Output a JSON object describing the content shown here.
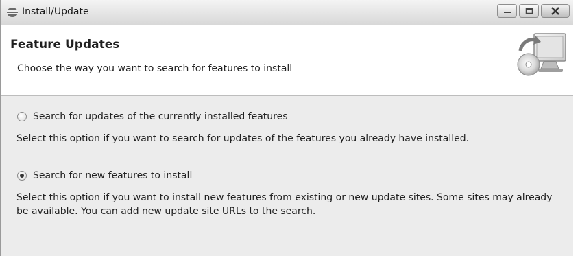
{
  "window": {
    "title": "Install/Update",
    "icon": "install-update-icon",
    "caption_buttons": [
      "minimize-icon",
      "maximize-icon",
      "close-icon"
    ]
  },
  "header": {
    "title": "Feature Updates",
    "description": "Choose the way you want to search for features to install",
    "banner_icon": "update-monitor-cd-icon"
  },
  "options": [
    {
      "label": "Search for updates of the currently installed features",
      "description": "Select this option if you want to search for updates of the features you already have installed.",
      "selected": false
    },
    {
      "label": "Search for new features to install",
      "description": "Select this option if you want to install new features from existing or new update sites. Some sites may already be available. You can add new update site URLs to the search.",
      "selected": true
    }
  ]
}
